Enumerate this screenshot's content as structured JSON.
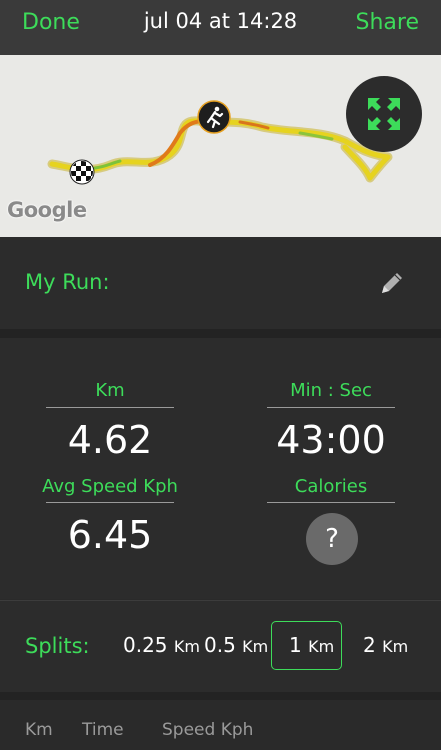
{
  "header": {
    "done_label": "Done",
    "title": "jul 04 at 14:28",
    "share_label": "Share"
  },
  "map": {
    "logo_text": "Google",
    "route_color": "#e0d020",
    "icons": [
      "finish-flag-icon",
      "runner-icon",
      "expand-icon"
    ]
  },
  "run": {
    "label": "My Run:",
    "edit_icon": "pencil-icon"
  },
  "stats": {
    "distance_label": "Km",
    "distance_value": "4.62",
    "time_label": "Min : Sec",
    "time_value": "43:00",
    "speed_label": "Avg Speed Kph",
    "speed_value": "6.45",
    "calories_label": "Calories",
    "calories_value": "?"
  },
  "splits": {
    "label": "Splits:",
    "options": [
      {
        "value": "0.25",
        "unit": "Km"
      },
      {
        "value": "0.5",
        "unit": "Km"
      },
      {
        "value": "1",
        "unit": "Km"
      },
      {
        "value": "2",
        "unit": "Km"
      }
    ],
    "selected": "1"
  },
  "table": {
    "columns": [
      "Km",
      "Time",
      "Speed Kph"
    ]
  },
  "colors": {
    "accent": "#3ddc5a",
    "background": "#2c2c2c",
    "header": "#3a3a3a"
  }
}
